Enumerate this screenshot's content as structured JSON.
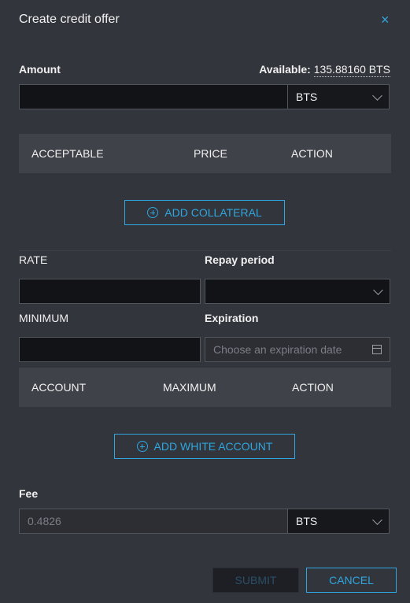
{
  "title": "Create credit offer",
  "close_symbol": "×",
  "amount": {
    "label": "Amount",
    "available_label": "Available:",
    "available_value": "135.88160 BTS",
    "value": "",
    "asset": "BTS"
  },
  "collateral_table": {
    "headers": [
      "ACCEPTABLE",
      "PRICE",
      "ACTION"
    ]
  },
  "add_collateral_label": "ADD COLLATERAL",
  "rate": {
    "label": "RATE",
    "value": ""
  },
  "repay_period": {
    "label": "Repay period",
    "value": ""
  },
  "minimum": {
    "label": "MINIMUM",
    "value": ""
  },
  "expiration": {
    "label": "Expiration",
    "placeholder": "Choose an expiration date"
  },
  "white_account_table": {
    "headers": [
      "ACCOUNT",
      "MAXIMUM",
      "ACTION"
    ]
  },
  "add_white_account_label": "ADD WHITE ACCOUNT",
  "fee": {
    "label": "Fee",
    "value": "0.4826",
    "asset": "BTS"
  },
  "submit_label": "SUBMIT",
  "cancel_label": "CANCEL",
  "colors": {
    "accent": "#2ea6df",
    "background": "#33353c"
  }
}
